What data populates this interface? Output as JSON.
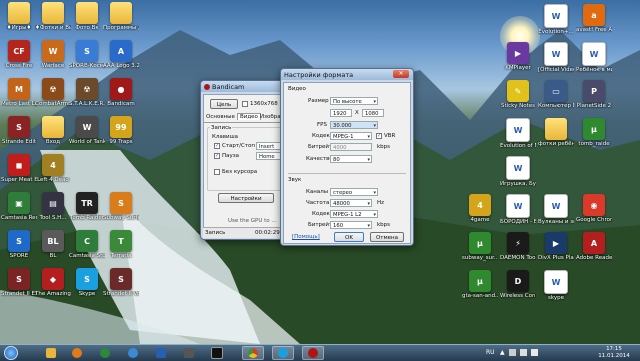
{
  "desktop": {
    "left_icons": [
      {
        "label": "♦Игры♦",
        "glyph": "",
        "color": "#e8b63a",
        "kind": "folder",
        "icon": "folder-icon"
      },
      {
        "label": "♦Фотки и Видео♦",
        "glyph": "",
        "color": "#e8b63a",
        "kind": "folder",
        "icon": "folder-icon"
      },
      {
        "label": "Фото Вк",
        "glyph": "",
        "color": "#e8b63a",
        "kind": "folder",
        "icon": "folder-icon"
      },
      {
        "label": "Программы для видео",
        "glyph": "",
        "color": "#e8b63a",
        "kind": "folder",
        "icon": "folder-icon"
      },
      {
        "label": "",
        "glyph": "",
        "color": "",
        "kind": "empty",
        "icon": ""
      },
      {
        "label": "",
        "glyph": "",
        "color": "",
        "kind": "empty",
        "icon": ""
      },
      {
        "label": "Cross Fire",
        "glyph": "CF",
        "color": "#b3261e",
        "kind": "app",
        "icon": "crossfire-icon"
      },
      {
        "label": "Warface",
        "glyph": "W",
        "color": "#c96a1a",
        "kind": "app",
        "icon": "warface-icon"
      },
      {
        "label": "SPORE-Космич. Приключе...",
        "glyph": "S",
        "color": "#3a7bd5",
        "kind": "app",
        "icon": "spore-icon"
      },
      {
        "label": "AAA Logo 3.2",
        "glyph": "A",
        "color": "#2a6ac9",
        "kind": "app",
        "icon": "aaa-logo-icon"
      },
      {
        "label": "",
        "glyph": "",
        "color": "",
        "kind": "empty",
        "icon": ""
      },
      {
        "label": "",
        "glyph": "",
        "color": "",
        "kind": "empty",
        "icon": ""
      },
      {
        "label": "Metro Last Light v.1.0...",
        "glyph": "M",
        "color": "#c4631a",
        "kind": "app",
        "icon": "metro-icon"
      },
      {
        "label": "CombatArms",
        "glyph": "☢",
        "color": "#8a4a1a",
        "kind": "app",
        "icon": "combatarms-icon"
      },
      {
        "label": "S.T.A.L.K.E.R. Тень Черно...",
        "glyph": "☢",
        "color": "#6b4a2a",
        "kind": "app",
        "icon": "stalker-icon"
      },
      {
        "label": "Bandicam",
        "glyph": "●",
        "color": "#a01818",
        "kind": "app",
        "icon": "bandicam-icon"
      },
      {
        "label": "",
        "glyph": "",
        "color": "",
        "kind": "empty",
        "icon": ""
      },
      {
        "label": "",
        "glyph": "",
        "color": "",
        "kind": "empty",
        "icon": ""
      },
      {
        "label": "Strande Edit",
        "glyph": "S",
        "color": "#8a2424",
        "kind": "app",
        "icon": "strande-icon"
      },
      {
        "label": "Вход",
        "glyph": "",
        "color": "#e8b63a",
        "kind": "folder",
        "icon": "folder-icon"
      },
      {
        "label": "World of Tanks",
        "glyph": "W",
        "color": "#4a4a4a",
        "kind": "app",
        "icon": "wot-icon"
      },
      {
        "label": "99 Traps",
        "glyph": "99",
        "color": "#d4a51a",
        "kind": "app",
        "icon": "traps-icon"
      },
      {
        "label": "",
        "glyph": "",
        "color": "",
        "kind": "empty",
        "icon": ""
      },
      {
        "label": "",
        "glyph": "",
        "color": "",
        "kind": "empty",
        "icon": ""
      },
      {
        "label": "Super Meat Boy",
        "glyph": "◼",
        "color": "#c21d1d",
        "kind": "app",
        "icon": "meatboy-icon"
      },
      {
        "label": "Left 4 Dead",
        "glyph": "4",
        "color": "#a08020",
        "kind": "app",
        "icon": "l4d-icon"
      },
      {
        "label": "",
        "glyph": "",
        "color": "",
        "kind": "empty",
        "icon": ""
      },
      {
        "label": "",
        "glyph": "",
        "color": "",
        "kind": "empty",
        "icon": ""
      },
      {
        "label": "",
        "glyph": "",
        "color": "",
        "kind": "empty",
        "icon": ""
      },
      {
        "label": "",
        "glyph": "",
        "color": "",
        "kind": "empty",
        "icon": ""
      },
      {
        "label": "Camtasia Recorder 8",
        "glyph": "▣",
        "color": "#2f7d3a",
        "kind": "app",
        "icon": "camtasia-recorder-icon"
      },
      {
        "label": "Tool S.H...",
        "glyph": "▤",
        "color": "#334",
        "kind": "app",
        "icon": "tool-icon"
      },
      {
        "label": "Tomb Raider",
        "glyph": "TR",
        "color": "#222",
        "kind": "app",
        "icon": "tombraider-icon"
      },
      {
        "label": "Subway Surfers",
        "glyph": "S",
        "color": "#d97c1a",
        "kind": "app",
        "icon": "subway-icon"
      },
      {
        "label": "",
        "glyph": "",
        "color": "",
        "kind": "empty",
        "icon": ""
      },
      {
        "label": "",
        "glyph": "",
        "color": "",
        "kind": "empty",
        "icon": ""
      },
      {
        "label": "SPORE",
        "glyph": "S",
        "color": "#1f6ac9",
        "kind": "app",
        "icon": "spore2-icon"
      },
      {
        "label": "BL",
        "glyph": "BL",
        "color": "#5a5a5a",
        "kind": "app",
        "icon": "bl-icon"
      },
      {
        "label": "Camtasia Studio 7",
        "glyph": "C",
        "color": "#2f7d3a",
        "kind": "app",
        "icon": "camtasia-icon"
      },
      {
        "label": "Terraria",
        "glyph": "T",
        "color": "#3a8a3a",
        "kind": "app",
        "icon": "terraria-icon"
      },
      {
        "label": "",
        "glyph": "",
        "color": "",
        "kind": "empty",
        "icon": ""
      },
      {
        "label": "",
        "glyph": "",
        "color": "",
        "kind": "empty",
        "icon": ""
      },
      {
        "label": "Strandet II Exit",
        "glyph": "S",
        "color": "#7a2424",
        "kind": "app",
        "icon": "strandet-icon"
      },
      {
        "label": "The Amazing Spider-Man",
        "glyph": "◆",
        "color": "#b31e1e",
        "kind": "app",
        "icon": "spiderman-icon"
      },
      {
        "label": "Skype",
        "glyph": "S",
        "color": "#1aa0e0",
        "kind": "app",
        "icon": "skype-icon"
      },
      {
        "label": "Strandet II Volta 7.0",
        "glyph": "S",
        "color": "#6a2a2a",
        "kind": "app",
        "icon": "strandet2-icon"
      },
      {
        "label": "",
        "glyph": "",
        "color": "",
        "kind": "empty",
        "icon": ""
      },
      {
        "label": "",
        "glyph": "",
        "color": "",
        "kind": "empty",
        "icon": ""
      }
    ],
    "right_icons": [
      {
        "label": "",
        "glyph": "",
        "color": "",
        "kind": "empty",
        "icon": ""
      },
      {
        "label": "",
        "glyph": "",
        "color": "",
        "kind": "empty",
        "icon": ""
      },
      {
        "label": "Evolution+...",
        "glyph": "W",
        "color": "#2a5fb0",
        "kind": "doc",
        "icon": "word-doc-icon"
      },
      {
        "label": "avast! Free Antivirus",
        "glyph": "a",
        "color": "#e06a10",
        "kind": "app",
        "icon": "avast-icon"
      },
      {
        "label": "",
        "glyph": "",
        "color": "",
        "kind": "empty",
        "icon": ""
      },
      {
        "label": "KMPlayer",
        "glyph": "▶",
        "color": "#6a3aa0",
        "kind": "app",
        "icon": "kmplayer-icon"
      },
      {
        "label": "[Official Video] D...",
        "glyph": "W",
        "color": "#2a5fb0",
        "kind": "doc",
        "icon": "word-doc-icon"
      },
      {
        "label": "Ребёнок в мире",
        "glyph": "W",
        "color": "#2a5fb0",
        "kind": "doc",
        "icon": "word-doc-icon"
      },
      {
        "label": "",
        "glyph": "",
        "color": "",
        "kind": "empty",
        "icon": ""
      },
      {
        "label": "Sticky Notes",
        "glyph": "✎",
        "color": "#e0c21a",
        "kind": "app",
        "icon": "sticky-notes-icon"
      },
      {
        "label": "Компьютер Главн...",
        "glyph": "▭",
        "color": "#3a5a8a",
        "kind": "app",
        "icon": "computer-icon"
      },
      {
        "label": "PlanetSide 2",
        "glyph": "P",
        "color": "#4a4a6a",
        "kind": "app",
        "icon": "planetside-icon"
      },
      {
        "label": "",
        "glyph": "",
        "color": "",
        "kind": "empty",
        "icon": ""
      },
      {
        "label": "Evolution of Music - Pe...",
        "glyph": "W",
        "color": "#2a5fb0",
        "kind": "doc",
        "icon": "word-doc-icon"
      },
      {
        "label": "фотки ребёнок лагерь Н...",
        "glyph": "",
        "color": "#e8b63a",
        "kind": "folder",
        "icon": "folder-icon"
      },
      {
        "label": "tomb_raide",
        "glyph": "µ",
        "color": "#2f8a2f",
        "kind": "app",
        "icon": "utorrent-icon"
      },
      {
        "label": "",
        "glyph": "",
        "color": "",
        "kind": "empty",
        "icon": ""
      },
      {
        "label": "Игрушка, Буря, смех...",
        "glyph": "W",
        "color": "#2a5fb0",
        "kind": "doc",
        "icon": "word-doc-icon"
      },
      {
        "label": "",
        "glyph": "",
        "color": "",
        "kind": "empty",
        "icon": ""
      },
      {
        "label": "",
        "glyph": "",
        "color": "",
        "kind": "empty",
        "icon": ""
      },
      {
        "label": "4game",
        "glyph": "4",
        "color": "#d4a51a",
        "kind": "app",
        "icon": "4game-icon"
      },
      {
        "label": "БОРОДИН - БИТВАГИ...",
        "glyph": "W",
        "color": "#2a5fb0",
        "kind": "doc",
        "icon": "word-doc-icon"
      },
      {
        "label": "Вулканы и звёзды",
        "glyph": "W",
        "color": "#2a5fb0",
        "kind": "doc",
        "icon": "word-doc-icon"
      },
      {
        "label": "Google Chrome",
        "glyph": "◉",
        "color": "#d93a2a",
        "kind": "app",
        "icon": "chrome-icon"
      },
      {
        "label": "subway_sur...",
        "glyph": "µ",
        "color": "#2f8a2f",
        "kind": "app",
        "icon": "utorrent2-icon"
      },
      {
        "label": "DAEMON Tools Lite",
        "glyph": "⚡",
        "color": "#1a1a1a",
        "kind": "app",
        "icon": "daemon-icon"
      },
      {
        "label": "DivX Plus Player",
        "glyph": "▶",
        "color": "#1a3a6a",
        "kind": "app",
        "icon": "divx-icon"
      },
      {
        "label": "Adobe Reader 9",
        "glyph": "A",
        "color": "#b31e1e",
        "kind": "app",
        "icon": "adobe-icon"
      },
      {
        "label": "gta-san-and...",
        "glyph": "µ",
        "color": "#2f8a2f",
        "kind": "app",
        "icon": "utorrent3-icon"
      },
      {
        "label": "Wireless Connection",
        "glyph": "D",
        "color": "#1a1a1a",
        "kind": "app",
        "icon": "dlink-icon"
      },
      {
        "label": "skype",
        "glyph": "W",
        "color": "#2a5fb0",
        "kind": "doc",
        "icon": "word-doc-icon"
      },
      {
        "label": "",
        "glyph": "",
        "color": "",
        "kind": "empty",
        "icon": ""
      }
    ]
  },
  "bandicam": {
    "title": "Bandicam",
    "target_button": "Цель",
    "resolution": "1360x768",
    "tabs": [
      "Основные",
      "Видео",
      "Изображ..."
    ],
    "record_group": "Запись",
    "hotkey_label": "Клавиша",
    "startstop_label": "Старт/Стоп",
    "startstop_key": "Insert",
    "pause_label": "Пауза",
    "pause_key": "Home",
    "nocursor_label": "Без курсора",
    "settings_button": "Настройки",
    "gpu_text": "Use the GPU to ...",
    "status_label": "Запись",
    "status_time": "00:02:29"
  },
  "format_dialog": {
    "title": "Настройки формата",
    "video_section": "Видео",
    "size_label": "Размер",
    "size_value": "По высоте",
    "res_w": "1920",
    "res_x": "X",
    "res_h": "1080",
    "fps_label": "FPS",
    "fps_value": "30.000",
    "codec_label": "Кодек",
    "codec_value": "MPEG-1",
    "vbr_label": "VBR",
    "bitrate_label": "Битрейт",
    "bitrate_value": "4000",
    "kbps": "kbps",
    "quality_label": "Качество",
    "quality_value": "80",
    "audio_section": "Звук",
    "channels_label": "Каналы",
    "channels_value": "стерео",
    "freq_label": "Частота",
    "freq_value": "48000",
    "hz": "Hz",
    "acodec_label": "Кодек",
    "acodec_value": "MPEG-1 L2",
    "abitrate_label": "Битрейт",
    "abitrate_value": "160",
    "akbps": "kbps",
    "help_link": "[Помощь]",
    "ok_button": "OK",
    "cancel_button": "Отмена"
  },
  "taskbar": {
    "lang": "RU",
    "time": "17:15",
    "date": "11.01.2014"
  }
}
